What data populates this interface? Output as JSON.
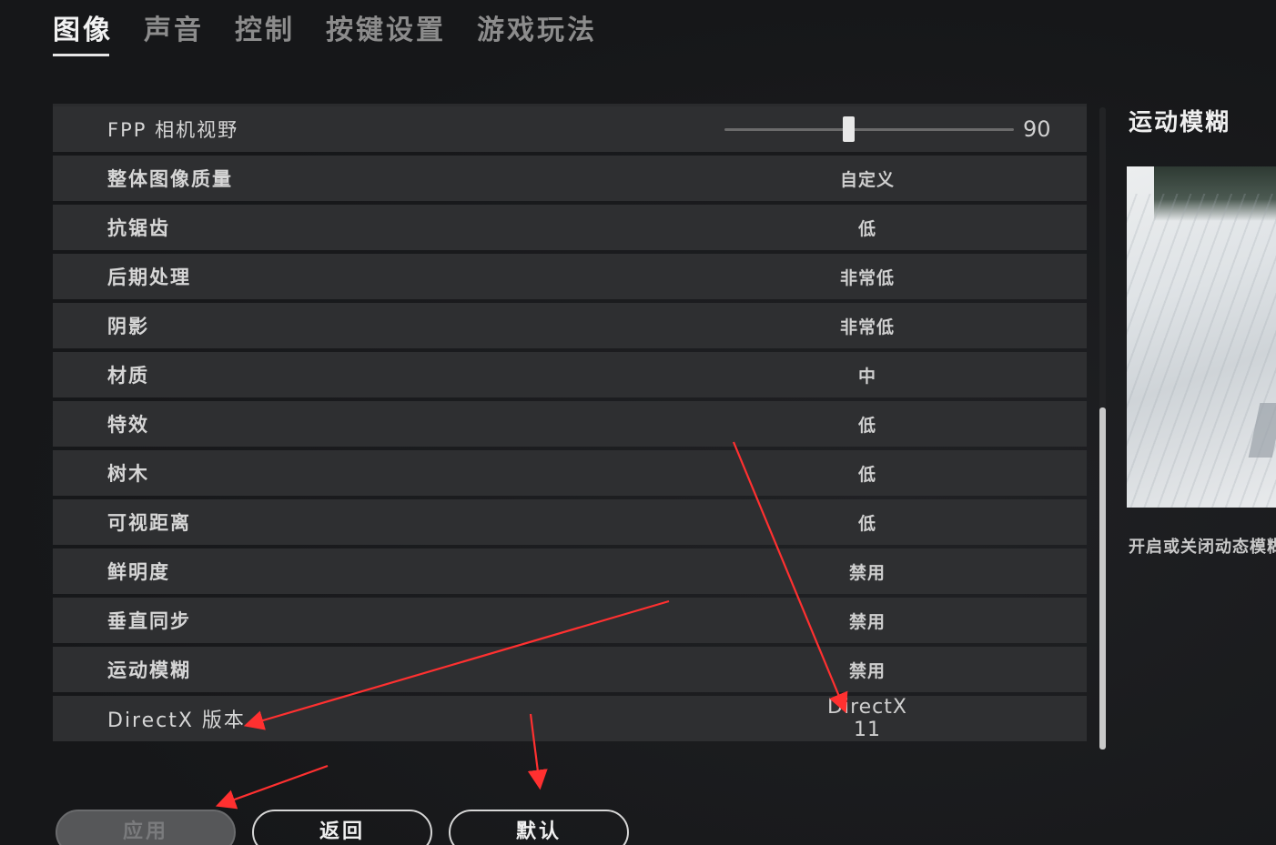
{
  "tabs": [
    {
      "label": "图像",
      "active": true
    },
    {
      "label": "声音",
      "active": false
    },
    {
      "label": "控制",
      "active": false
    },
    {
      "label": "按键设置",
      "active": false
    },
    {
      "label": "游戏玩法",
      "active": false
    }
  ],
  "settings": {
    "fpp": {
      "label": "FPP 相机视野",
      "value": "90",
      "slider_fraction": 0.43
    },
    "rows": [
      {
        "label": "整体图像质量",
        "value": "自定义"
      },
      {
        "label": "抗锯齿",
        "value": "低"
      },
      {
        "label": "后期处理",
        "value": "非常低"
      },
      {
        "label": "阴影",
        "value": "非常低"
      },
      {
        "label": "材质",
        "value": "中"
      },
      {
        "label": "特效",
        "value": "低"
      },
      {
        "label": "树木",
        "value": "低"
      },
      {
        "label": "可视距离",
        "value": "低"
      },
      {
        "label": "鲜明度",
        "value": "禁用"
      },
      {
        "label": "垂直同步",
        "value": "禁用"
      },
      {
        "label": "运动模糊",
        "value": "禁用"
      },
      {
        "label": "DirectX 版本",
        "value": "DirectX 11"
      }
    ]
  },
  "panel": {
    "title": "运动模糊",
    "description": "开启或关闭动态模糊"
  },
  "buttons": {
    "apply": "应用",
    "back": "返回",
    "default": "默认"
  },
  "colors": {
    "annotation_arrow": "#ff3030",
    "row_background": "#2e2f31",
    "page_background": "#17181a"
  }
}
